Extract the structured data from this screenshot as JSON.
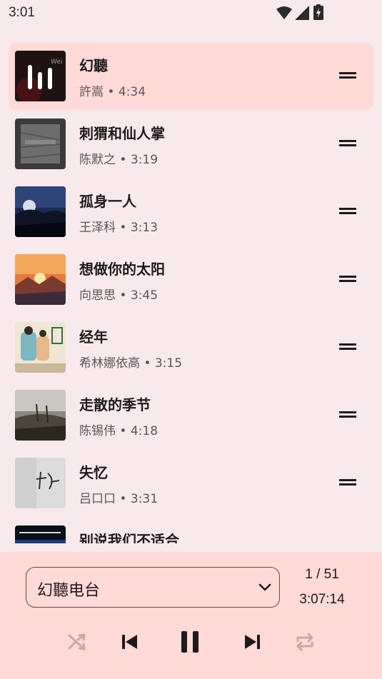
{
  "status_bar": {
    "time": "3:01",
    "icons": [
      "wifi-icon",
      "cellular-signal-icon",
      "battery-charging-icon"
    ]
  },
  "tracks": [
    {
      "title": "幻聽",
      "subtitle": "許嵩 • 4:34",
      "cover": "cover-art-sound-bars",
      "active": true
    },
    {
      "title": "刺猬和仙人掌",
      "subtitle": "陈默之 • 3:19",
      "cover": "cover-art-gray-texture"
    },
    {
      "title": "孤身一人",
      "subtitle": "王泽科 • 3:13",
      "cover": "cover-art-night-sky"
    },
    {
      "title": "想做你的太阳",
      "subtitle": "向思思 • 3:45",
      "cover": "cover-art-sunset"
    },
    {
      "title": "经年",
      "subtitle": "希林娜依高 • 3:15",
      "cover": "cover-art-illustration"
    },
    {
      "title": "走散的季节",
      "subtitle": "陈锡伟 • 4:18",
      "cover": "cover-art-misty-forest"
    },
    {
      "title": "失忆",
      "subtitle": "吕口口 • 3:31",
      "cover": "cover-art-handwriting"
    },
    {
      "title": "别说我们不适合",
      "subtitle": "",
      "cover": "cover-art-dark-blue"
    }
  ],
  "player": {
    "playlist_name": "幻聽电台",
    "queue_position": "1 / 51",
    "total_duration": "3:07:14",
    "controls": [
      "shuffle-icon",
      "skip-previous-icon",
      "pause-icon",
      "skip-next-icon",
      "repeat-icon"
    ]
  },
  "colors": {
    "background": "#f7e9ec",
    "active_row": "#ffdad6",
    "player_panel": "#ffdad6",
    "disabled_icon": "#c9a9a6"
  }
}
